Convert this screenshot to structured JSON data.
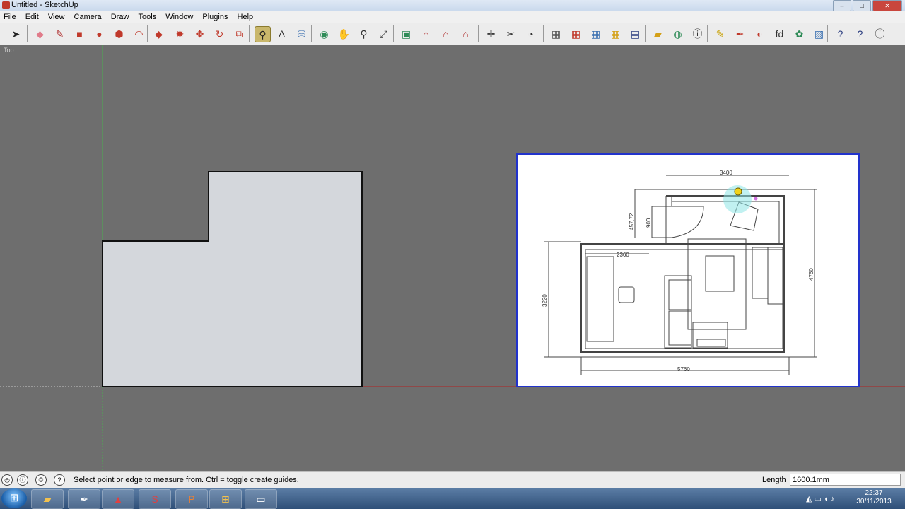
{
  "window": {
    "title": "Untitled - SketchUp",
    "buttons": [
      "–",
      "□",
      "✕"
    ]
  },
  "menu": [
    "File",
    "Edit",
    "View",
    "Camera",
    "Draw",
    "Tools",
    "Window",
    "Plugins",
    "Help"
  ],
  "toolbar": [
    {
      "name": "select-tool-icon",
      "glyph": "➤",
      "color": "#222222"
    },
    {
      "name": "eraser-tool-icon",
      "glyph": "◆",
      "color": "#e07b8a"
    },
    {
      "name": "pencil-tool-icon",
      "glyph": "✎",
      "color": "#b03030"
    },
    {
      "name": "rectangle-tool-icon",
      "glyph": "■",
      "color": "#c0392b"
    },
    {
      "name": "circle-tool-icon",
      "glyph": "●",
      "color": "#c0392b"
    },
    {
      "name": "polygon-tool-icon",
      "glyph": "⬢",
      "color": "#c0392b"
    },
    {
      "name": "arc-tool-icon",
      "glyph": "◠",
      "color": "#c0392b"
    },
    {
      "name": "push-pull-tool-icon",
      "glyph": "◆",
      "color": "#c0392b"
    },
    {
      "name": "follow-me-tool-icon",
      "glyph": "✸",
      "color": "#c0392b"
    },
    {
      "name": "move-tool-icon",
      "glyph": "✥",
      "color": "#c0392b"
    },
    {
      "name": "rotate-tool-icon",
      "glyph": "↻",
      "color": "#c0392b"
    },
    {
      "name": "scale-tool-icon",
      "glyph": "⧉",
      "color": "#c0392b"
    },
    {
      "name": "tape-measure-tool-icon",
      "glyph": "⚲",
      "color": "#222222",
      "active": true
    },
    {
      "name": "text-tool-icon",
      "glyph": "A",
      "color": "#333333"
    },
    {
      "name": "paint-bucket-icon",
      "glyph": "⛁",
      "color": "#3a6fb0"
    },
    {
      "name": "orbit-tool-icon",
      "glyph": "◉",
      "color": "#2e8b57"
    },
    {
      "name": "pan-tool-icon",
      "glyph": "✋",
      "color": "#555555"
    },
    {
      "name": "zoom-tool-icon",
      "glyph": "⚲",
      "color": "#333333"
    },
    {
      "name": "zoom-extents-icon",
      "glyph": "⤢",
      "color": "#333333"
    },
    {
      "name": "component-icon",
      "glyph": "▣",
      "color": "#2e8b57"
    },
    {
      "name": "iso-view-icon",
      "glyph": "⌂",
      "color": "#b03030"
    },
    {
      "name": "top-view-icon",
      "glyph": "⌂",
      "color": "#b03030"
    },
    {
      "name": "front-view-icon",
      "glyph": "⌂",
      "color": "#b03030"
    },
    {
      "name": "axes-icon",
      "glyph": "✛",
      "color": "#222222"
    },
    {
      "name": "section-plane-icon",
      "glyph": "✂",
      "color": "#333333"
    },
    {
      "name": "walk-tool-icon",
      "glyph": "◔",
      "color": "#333333"
    },
    {
      "name": "import-icon",
      "glyph": "▦",
      "color": "#555555"
    },
    {
      "name": "export-icon",
      "glyph": "▦",
      "color": "#c0392b"
    },
    {
      "name": "photo-match-icon",
      "glyph": "▦",
      "color": "#3a6fb0"
    },
    {
      "name": "fire-icon",
      "glyph": "▦",
      "color": "#d4a017"
    },
    {
      "name": "save-icon",
      "glyph": "▤",
      "color": "#2c3e80"
    },
    {
      "name": "folder-icon",
      "glyph": "▰",
      "color": "#d4a017"
    },
    {
      "name": "globe-icon",
      "glyph": "◍",
      "color": "#2e8b57"
    },
    {
      "name": "model-info-icon",
      "glyph": "ⓘ",
      "color": "#333333"
    },
    {
      "name": "pencil-plugin-icon",
      "glyph": "✎",
      "color": "#c8a000"
    },
    {
      "name": "eyedropper-icon",
      "glyph": "✒",
      "color": "#c0392b"
    },
    {
      "name": "sphere-icon",
      "glyph": "◐",
      "color": "#c0392b"
    },
    {
      "name": "fd-plugin-icon",
      "glyph": "fd",
      "color": "#333333"
    },
    {
      "name": "plant-icon",
      "glyph": "✿",
      "color": "#2e8b57"
    },
    {
      "name": "image-plugin-icon",
      "glyph": "▨",
      "color": "#3a6fb0"
    },
    {
      "name": "help-icon",
      "glyph": "?",
      "color": "#2c3e80"
    },
    {
      "name": "help-question-icon",
      "glyph": "?",
      "color": "#2c3e80"
    },
    {
      "name": "info-icon",
      "glyph": "ⓘ",
      "color": "#333333"
    }
  ],
  "scene": {
    "view_label": "Top",
    "plan": {
      "dims": {
        "top": "3400",
        "left_top": "457,72",
        "inner_left": "900",
        "mid": "2360",
        "left": "3220",
        "right": "4760",
        "bottom": "5760"
      }
    }
  },
  "status": {
    "message": "Select point or edge to measure from.  Ctrl = toggle create guides.",
    "vcb_label": "Length",
    "vcb_value": "1600.1mm",
    "icons": [
      "geo-location-icon",
      "credits-icon",
      "help-icon"
    ]
  },
  "taskbar": {
    "apps": [
      {
        "name": "explorer-task-icon",
        "glyph": "▰",
        "color": "#f2c14e"
      },
      {
        "name": "inkscape-task-icon",
        "glyph": "✒",
        "color": "#ffffff"
      },
      {
        "name": "acrobat-task-icon",
        "glyph": "▲",
        "color": "#e04040"
      },
      {
        "name": "sketchup-task-icon",
        "glyph": "S",
        "color": "#e04040"
      },
      {
        "name": "powerpoint-task-icon",
        "glyph": "P",
        "color": "#f08030"
      },
      {
        "name": "windows-task-icon",
        "glyph": "⊞",
        "color": "#f2c14e"
      },
      {
        "name": "window-task-icon",
        "glyph": "▭",
        "color": "#ffffff"
      }
    ],
    "time": "22:37",
    "date": "30/11/2013"
  }
}
